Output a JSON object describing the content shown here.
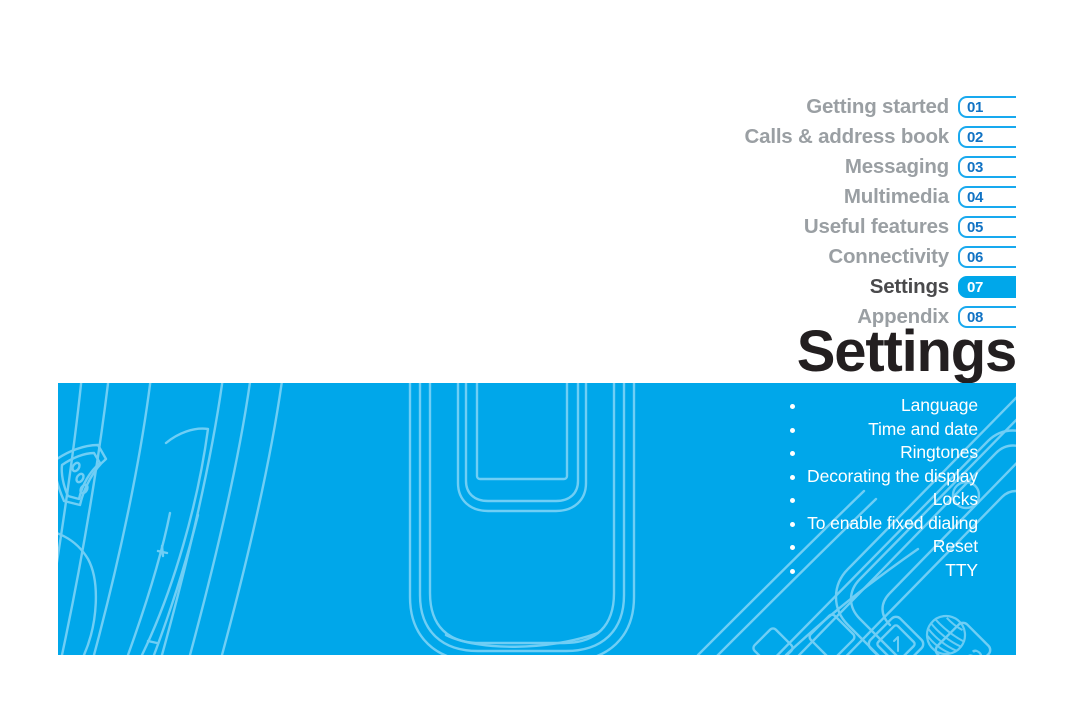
{
  "document": {
    "page_title": "Settings",
    "title_color": "#231f20",
    "accent_color": "#00a7ea",
    "tab_outline_color": "#18a9ef",
    "tab_number_color": "#1173c4",
    "inactive_label_color": "#9a9fa3",
    "active_label_color": "#4a4a4c",
    "banner_color": "#00a7ea",
    "banner_line_color": "#6fcef5"
  },
  "chapter_index": {
    "items": [
      {
        "label": "Getting started",
        "number": "01",
        "active": false
      },
      {
        "label": "Calls & address book",
        "number": "02",
        "active": false
      },
      {
        "label": "Messaging",
        "number": "03",
        "active": false
      },
      {
        "label": "Multimedia",
        "number": "04",
        "active": false
      },
      {
        "label": "Useful features",
        "number": "05",
        "active": false
      },
      {
        "label": "Connectivity",
        "number": "06",
        "active": false
      },
      {
        "label": "Settings",
        "number": "07",
        "active": true
      },
      {
        "label": "Appendix",
        "number": "08",
        "active": false
      }
    ]
  },
  "banner": {
    "topics": [
      "Language",
      "Time and date",
      "Ringtones",
      "Decorating the display",
      "Locks",
      "To enable fixed dialing",
      "Reset",
      "TTY"
    ],
    "artwork": "flip-phone-line-art",
    "logo": "att-globe-logo"
  }
}
